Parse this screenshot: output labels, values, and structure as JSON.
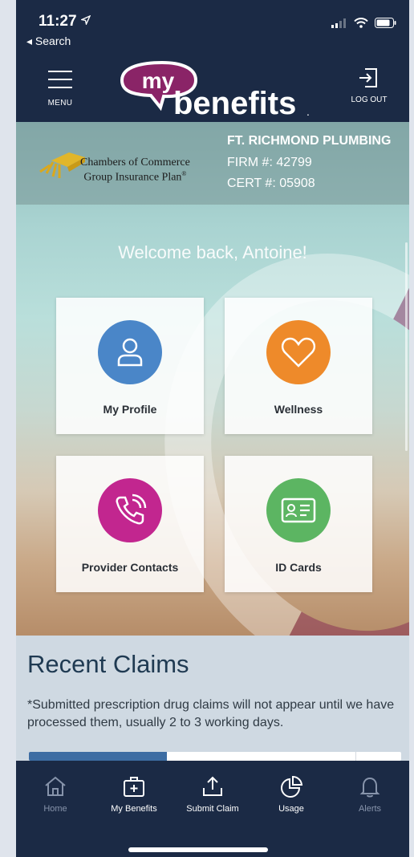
{
  "status": {
    "time": "11:27",
    "back_label": "◂ Search"
  },
  "header": {
    "menu_label": "MENU",
    "logout_label": "LOG OUT",
    "logo_my": "my",
    "logo_benefits": "benefits",
    "logo_mark": "."
  },
  "firm": {
    "plan_line1": "Chambers of Commerce",
    "plan_line2": "Group Insurance Plan",
    "plan_mark": "®",
    "name": "FT. RICHMOND PLUMBING",
    "firm_number": "FIRM #: 42799",
    "cert_number": "CERT #: 05908"
  },
  "welcome": "Welcome back, Antoine!",
  "tiles": [
    {
      "label": "My Profile",
      "icon": "person-icon",
      "color": "#4a86c8"
    },
    {
      "label": "Wellness",
      "icon": "heart-icon",
      "color": "#ee8a2a"
    },
    {
      "label": "Provider Contacts",
      "icon": "phone-call-icon",
      "color": "#c2268f"
    },
    {
      "label": "ID Cards",
      "icon": "id-card-icon",
      "color": "#5cb562"
    }
  ],
  "claims": {
    "title": "Recent Claims",
    "note": "*Submitted prescription drug claims will not appear until we have processed them, usually 2 to 3 working days.",
    "progress_fraction": 0.37
  },
  "tabs": [
    {
      "label": "Home",
      "icon": "home-icon",
      "active": true
    },
    {
      "label": "My Benefits",
      "icon": "medical-kit-icon"
    },
    {
      "label": "Submit Claim",
      "icon": "upload-icon"
    },
    {
      "label": "Usage",
      "icon": "pie-chart-icon"
    },
    {
      "label": "Alerts",
      "icon": "bell-icon",
      "muted": true
    }
  ],
  "colors": {
    "navy": "#1b2a45",
    "brand_purple": "#8a2467",
    "progress_blue": "#3d6da3"
  }
}
